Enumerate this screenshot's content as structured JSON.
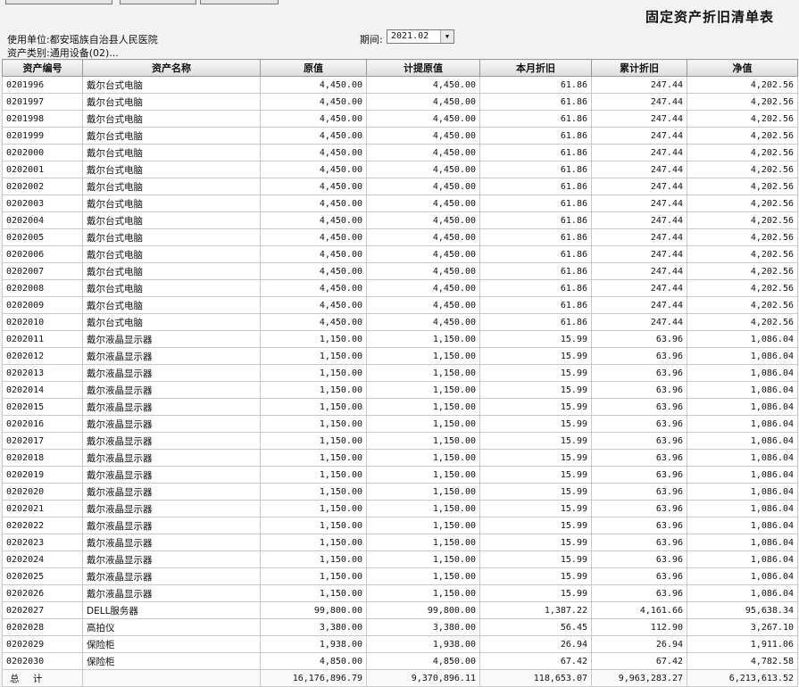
{
  "report": {
    "title": "固定资产折旧清单表",
    "unit": "使用单位:都安瑶族自治县人民医院",
    "category": "资产类别:通用设备(02)...",
    "period_label": "期间:",
    "period_value": "2021.02"
  },
  "columns": [
    "资产编号",
    "资产名称",
    "原值",
    "计提原值",
    "本月折旧",
    "累计折旧",
    "净值"
  ],
  "rows": [
    [
      "0201996",
      "戴尔台式电脑",
      "4,450.00",
      "4,450.00",
      "61.86",
      "247.44",
      "4,202.56"
    ],
    [
      "0201997",
      "戴尔台式电脑",
      "4,450.00",
      "4,450.00",
      "61.86",
      "247.44",
      "4,202.56"
    ],
    [
      "0201998",
      "戴尔台式电脑",
      "4,450.00",
      "4,450.00",
      "61.86",
      "247.44",
      "4,202.56"
    ],
    [
      "0201999",
      "戴尔台式电脑",
      "4,450.00",
      "4,450.00",
      "61.86",
      "247.44",
      "4,202.56"
    ],
    [
      "0202000",
      "戴尔台式电脑",
      "4,450.00",
      "4,450.00",
      "61.86",
      "247.44",
      "4,202.56"
    ],
    [
      "0202001",
      "戴尔台式电脑",
      "4,450.00",
      "4,450.00",
      "61.86",
      "247.44",
      "4,202.56"
    ],
    [
      "0202002",
      "戴尔台式电脑",
      "4,450.00",
      "4,450.00",
      "61.86",
      "247.44",
      "4,202.56"
    ],
    [
      "0202003",
      "戴尔台式电脑",
      "4,450.00",
      "4,450.00",
      "61.86",
      "247.44",
      "4,202.56"
    ],
    [
      "0202004",
      "戴尔台式电脑",
      "4,450.00",
      "4,450.00",
      "61.86",
      "247.44",
      "4,202.56"
    ],
    [
      "0202005",
      "戴尔台式电脑",
      "4,450.00",
      "4,450.00",
      "61.86",
      "247.44",
      "4,202.56"
    ],
    [
      "0202006",
      "戴尔台式电脑",
      "4,450.00",
      "4,450.00",
      "61.86",
      "247.44",
      "4,202.56"
    ],
    [
      "0202007",
      "戴尔台式电脑",
      "4,450.00",
      "4,450.00",
      "61.86",
      "247.44",
      "4,202.56"
    ],
    [
      "0202008",
      "戴尔台式电脑",
      "4,450.00",
      "4,450.00",
      "61.86",
      "247.44",
      "4,202.56"
    ],
    [
      "0202009",
      "戴尔台式电脑",
      "4,450.00",
      "4,450.00",
      "61.86",
      "247.44",
      "4,202.56"
    ],
    [
      "0202010",
      "戴尔台式电脑",
      "4,450.00",
      "4,450.00",
      "61.86",
      "247.44",
      "4,202.56"
    ],
    [
      "0202011",
      "戴尔液晶显示器",
      "1,150.00",
      "1,150.00",
      "15.99",
      "63.96",
      "1,086.04"
    ],
    [
      "0202012",
      "戴尔液晶显示器",
      "1,150.00",
      "1,150.00",
      "15.99",
      "63.96",
      "1,086.04"
    ],
    [
      "0202013",
      "戴尔液晶显示器",
      "1,150.00",
      "1,150.00",
      "15.99",
      "63.96",
      "1,086.04"
    ],
    [
      "0202014",
      "戴尔液晶显示器",
      "1,150.00",
      "1,150.00",
      "15.99",
      "63.96",
      "1,086.04"
    ],
    [
      "0202015",
      "戴尔液晶显示器",
      "1,150.00",
      "1,150.00",
      "15.99",
      "63.96",
      "1,086.04"
    ],
    [
      "0202016",
      "戴尔液晶显示器",
      "1,150.00",
      "1,150.00",
      "15.99",
      "63.96",
      "1,086.04"
    ],
    [
      "0202017",
      "戴尔液晶显示器",
      "1,150.00",
      "1,150.00",
      "15.99",
      "63.96",
      "1,086.04"
    ],
    [
      "0202018",
      "戴尔液晶显示器",
      "1,150.00",
      "1,150.00",
      "15.99",
      "63.96",
      "1,086.04"
    ],
    [
      "0202019",
      "戴尔液晶显示器",
      "1,150.00",
      "1,150.00",
      "15.99",
      "63.96",
      "1,086.04"
    ],
    [
      "0202020",
      "戴尔液晶显示器",
      "1,150.00",
      "1,150.00",
      "15.99",
      "63.96",
      "1,086.04"
    ],
    [
      "0202021",
      "戴尔液晶显示器",
      "1,150.00",
      "1,150.00",
      "15.99",
      "63.96",
      "1,086.04"
    ],
    [
      "0202022",
      "戴尔液晶显示器",
      "1,150.00",
      "1,150.00",
      "15.99",
      "63.96",
      "1,086.04"
    ],
    [
      "0202023",
      "戴尔液晶显示器",
      "1,150.00",
      "1,150.00",
      "15.99",
      "63.96",
      "1,086.04"
    ],
    [
      "0202024",
      "戴尔液晶显示器",
      "1,150.00",
      "1,150.00",
      "15.99",
      "63.96",
      "1,086.04"
    ],
    [
      "0202025",
      "戴尔液晶显示器",
      "1,150.00",
      "1,150.00",
      "15.99",
      "63.96",
      "1,086.04"
    ],
    [
      "0202026",
      "戴尔液晶显示器",
      "1,150.00",
      "1,150.00",
      "15.99",
      "63.96",
      "1,086.04"
    ],
    [
      "0202027",
      "DELL服务器",
      "99,800.00",
      "99,800.00",
      "1,387.22",
      "4,161.66",
      "95,638.34"
    ],
    [
      "0202028",
      "高拍仪",
      "3,380.00",
      "3,380.00",
      "56.45",
      "112.90",
      "3,267.10"
    ],
    [
      "0202029",
      "保险柜",
      "1,938.00",
      "1,938.00",
      "26.94",
      "26.94",
      "1,911.06"
    ],
    [
      "0202030",
      "保险柜",
      "4,850.00",
      "4,850.00",
      "67.42",
      "67.42",
      "4,782.58"
    ]
  ],
  "total": {
    "label": "总 计",
    "values": [
      "16,176,896.79",
      "9,370,896.11",
      "118,653.07",
      "9,963,283.27",
      "6,213,613.52"
    ]
  }
}
